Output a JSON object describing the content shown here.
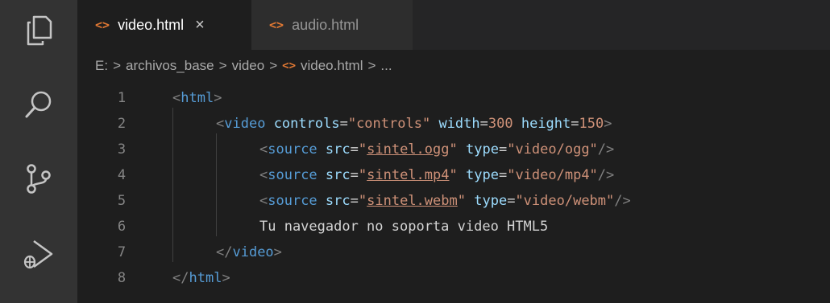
{
  "tabs": [
    {
      "label": "video.html",
      "active": true,
      "close": "×"
    },
    {
      "label": "audio.html",
      "active": false
    }
  ],
  "tab_icon": "<>",
  "breadcrumb": {
    "items": [
      "E:",
      "archivos_base",
      "video",
      "video.html",
      "..."
    ],
    "separator": ">"
  },
  "editor": {
    "lines": [
      {
        "number": "1"
      },
      {
        "number": "2"
      },
      {
        "number": "3"
      },
      {
        "number": "4"
      },
      {
        "number": "5"
      },
      {
        "number": "6"
      },
      {
        "number": "7"
      },
      {
        "number": "8"
      }
    ],
    "code": {
      "l1": {
        "open": "<",
        "tag": "html",
        "close": ">"
      },
      "l2": {
        "open": "<",
        "tag": "video",
        "attr1": "controls",
        "eq": "=",
        "val1": "\"controls\"",
        "attr2": "width",
        "val2": "300",
        "attr3": "height",
        "val3": "150",
        "close": ">"
      },
      "l3": {
        "open": "<",
        "tag": "source",
        "attr1": "src",
        "eq": "=",
        "q": "\"",
        "val1": "sintel.ogg",
        "attr2": "type",
        "val2": "\"video/ogg\"",
        "close": "/>"
      },
      "l4": {
        "open": "<",
        "tag": "source",
        "attr1": "src",
        "eq": "=",
        "q": "\"",
        "val1": "sintel.mp4",
        "attr2": "type",
        "val2": "\"video/mp4\"",
        "close": "/>"
      },
      "l5": {
        "open": "<",
        "tag": "source",
        "attr1": "src",
        "eq": "=",
        "q": "\"",
        "val1": "sintel.webm",
        "attr2": "type",
        "val2": "\"video/webm\"",
        "close": "/>"
      },
      "l6": {
        "text": "Tu navegador no soporta video HTML5"
      },
      "l7": {
        "open": "</",
        "tag": "video",
        "close": ">"
      },
      "l8": {
        "open": "</",
        "tag": "html",
        "close": ">"
      }
    }
  },
  "colors": {
    "background": "#1e1e1e",
    "activity_bar": "#333333",
    "tag": "#569cd6",
    "attribute": "#9cdcfe",
    "string": "#ce9178",
    "html_icon": "#e37933"
  },
  "icons": [
    "explorer-icon",
    "search-icon",
    "source-control-icon",
    "run-debug-icon"
  ]
}
